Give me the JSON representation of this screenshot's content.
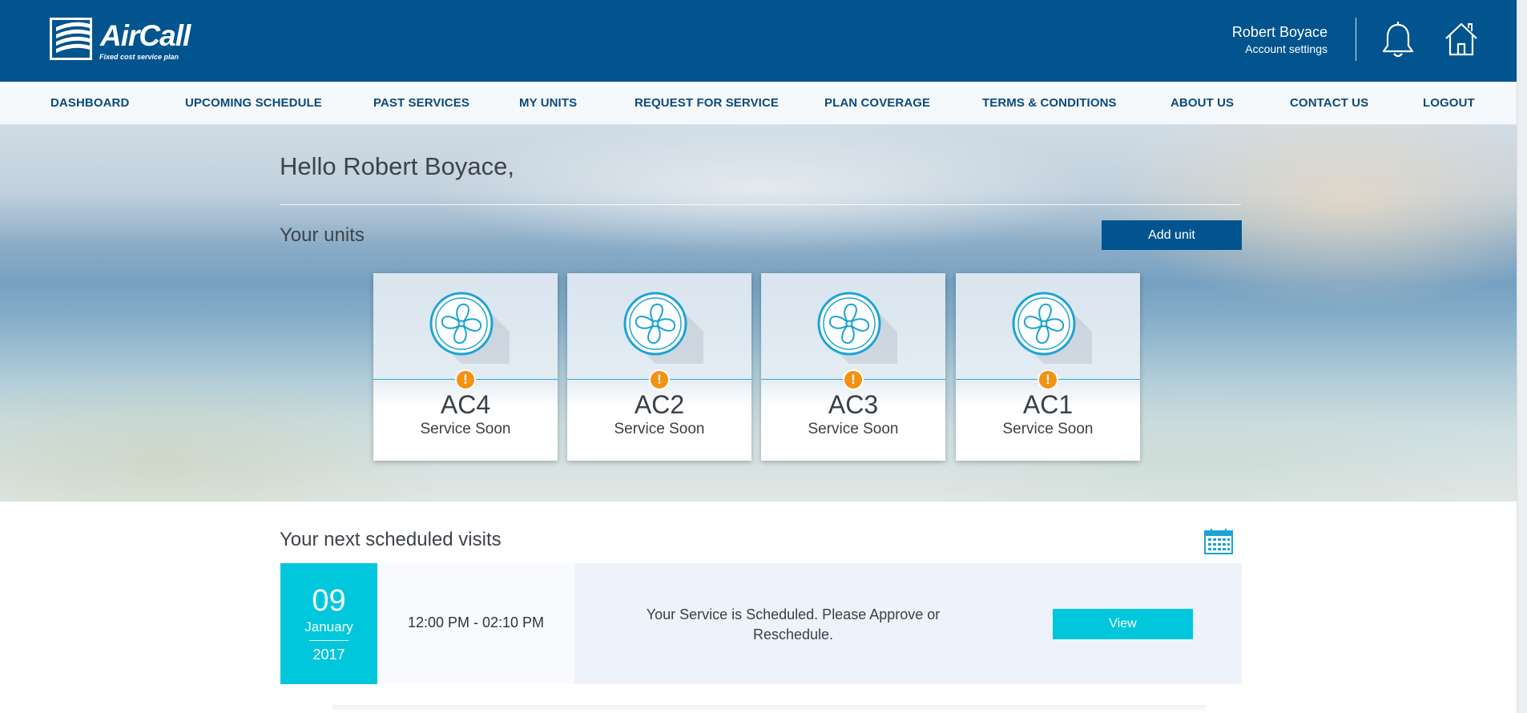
{
  "app": {
    "brand": "AirCall",
    "tagline": "Fixed cost service plan"
  },
  "header": {
    "user_name": "Robert Boyace",
    "account_settings": "Account settings",
    "icons": [
      "bell-icon",
      "home-icon"
    ]
  },
  "nav": {
    "items": [
      "DASHBOARD",
      "UPCOMING SCHEDULE",
      "PAST SERVICES",
      "MY UNITS",
      "REQUEST FOR SERVICE",
      "PLAN COVERAGE",
      "TERMS & CONDITIONS",
      "ABOUT US",
      "CONTACT US",
      "LOGOUT"
    ]
  },
  "hero": {
    "greeting": "Hello Robert Boyace,",
    "units_title": "Your units",
    "add_unit_label": "Add unit",
    "units": [
      {
        "name": "AC4",
        "status": "Service Soon"
      },
      {
        "name": "AC2",
        "status": "Service Soon"
      },
      {
        "name": "AC3",
        "status": "Service Soon"
      },
      {
        "name": "AC1",
        "status": "Service Soon"
      }
    ],
    "alert_glyph": "!"
  },
  "schedule": {
    "title": "Your next scheduled visits",
    "visits": [
      {
        "day": "09",
        "month": "January",
        "year": "2017",
        "time": "12:00 PM - 02:10 PM",
        "message": "Your Service is Scheduled. Please Approve or Reschedule.",
        "view_label": "View"
      }
    ]
  },
  "colors": {
    "brand_blue": "#02548f",
    "accent_cyan": "#00c7dc",
    "alert_orange": "#f39212",
    "fan_blue": "#1ba3d6"
  }
}
